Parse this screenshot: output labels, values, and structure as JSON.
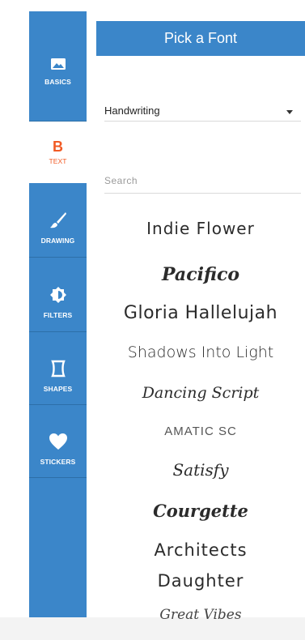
{
  "sidebar": {
    "items": [
      {
        "label": "BASICS",
        "icon": "image-icon"
      },
      {
        "label": "TEXT",
        "icon": "bold-b-icon",
        "glyph": "B",
        "active": true
      },
      {
        "label": "DRAWING",
        "icon": "brush-icon"
      },
      {
        "label": "FILTERS",
        "icon": "brightness-icon"
      },
      {
        "label": "SHAPES",
        "icon": "shape-icon"
      },
      {
        "label": "STICKERS",
        "icon": "heart-icon"
      }
    ]
  },
  "panel": {
    "title": "Pick a Font",
    "category_select": {
      "value": "Handwriting"
    },
    "search": {
      "placeholder": "Search",
      "value": ""
    },
    "fonts": [
      "Indie Flower",
      "Pacifico",
      "Gloria Hallelujah",
      "Shadows Into Light",
      "Dancing Script",
      "AMATIC SC",
      "Satisfy",
      "Courgette",
      "Architects",
      "Daughter",
      "Great Vibes"
    ]
  },
  "colors": {
    "accent_blue": "#3b86c9",
    "active_orange": "#f15a24"
  }
}
